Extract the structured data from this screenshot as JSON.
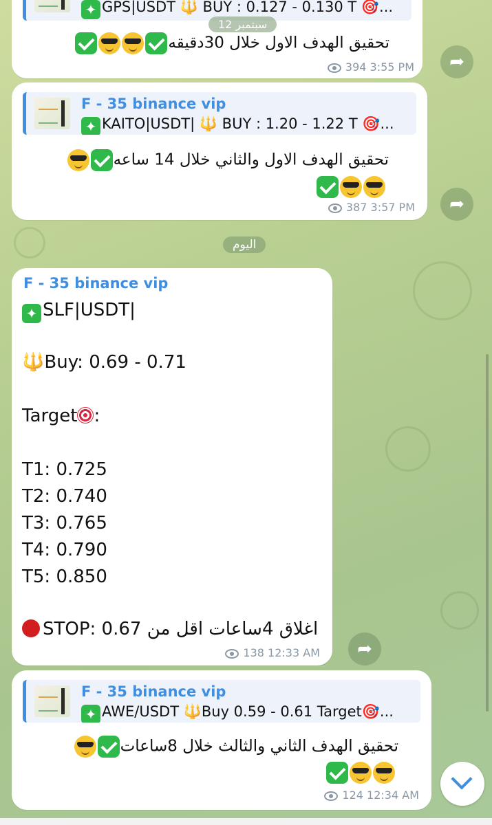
{
  "date_separators": {
    "top": "12 سبتمبر",
    "today": "اليوم"
  },
  "messages": [
    {
      "reply_text": "GPS|USDT 🔱 BUY : 0.127 - 0.130 T 🎯...",
      "arabic": "تحقيق الهدف الاول خلال 30دقيقه",
      "views": "394",
      "time": "3:55 PM"
    },
    {
      "reply_name": "F - 35 binance vip",
      "reply_text": "KAITO|USDT| 🔱 BUY : 1.20 - 1.22 T 🎯...",
      "arabic": "تحقيق الهدف الاول والثاني خلال 14 ساعه",
      "views": "387",
      "time": "3:57 PM"
    },
    {
      "sender": "F - 35 binance vip",
      "pair": "SLF|USDT|",
      "buy": "Buy: 0.69 -  0.71",
      "target_label": "Target",
      "targets": [
        "T1: 0.725",
        "T2: 0.740",
        "T3: 0.765",
        "T4: 0.790",
        "T5: 0.850"
      ],
      "stop": "STOP: 0.67 اغلاق 4ساعات اقل من",
      "views": "138",
      "time": "12:33 AM"
    },
    {
      "reply_name": "F - 35 binance vip",
      "reply_text": "AWE/USDT 🔱Buy 0.59 - 0.61 Target🎯...",
      "arabic": "تحقيق الهدف الثاني والثالث خلال 8ساعات",
      "views": "124",
      "time": "12:34 AM"
    }
  ],
  "icons": {
    "forward": "forward-arrow-icon",
    "views": "eye-icon",
    "scroll_down": "chevron-down-icon",
    "check": "check-mark-emoji",
    "sunglasses": "sunglasses-emoji"
  },
  "colors": {
    "accent": "#3f8ee0",
    "bubble": "#ffffff",
    "check": "#2fb94a"
  }
}
